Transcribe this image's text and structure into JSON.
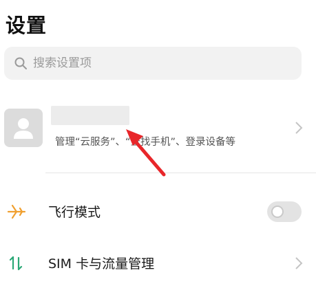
{
  "header": {
    "title": "设置"
  },
  "search": {
    "placeholder": "搜索设置项",
    "icon": "search-icon"
  },
  "account": {
    "subtitle": "管理“云服务”、“查找手机”、登录设备等",
    "avatar_icon": "person-icon"
  },
  "settings": [
    {
      "label": "飞行模式",
      "icon": "airplane-icon",
      "control": "toggle",
      "on": false
    },
    {
      "label": "SIM 卡与流量管理",
      "icon": "sim-data-icon",
      "control": "chevron"
    }
  ],
  "colors": {
    "airplane_icon": "#f0a030",
    "sim_icon": "#2aa876",
    "arrow": "#e8262a"
  }
}
